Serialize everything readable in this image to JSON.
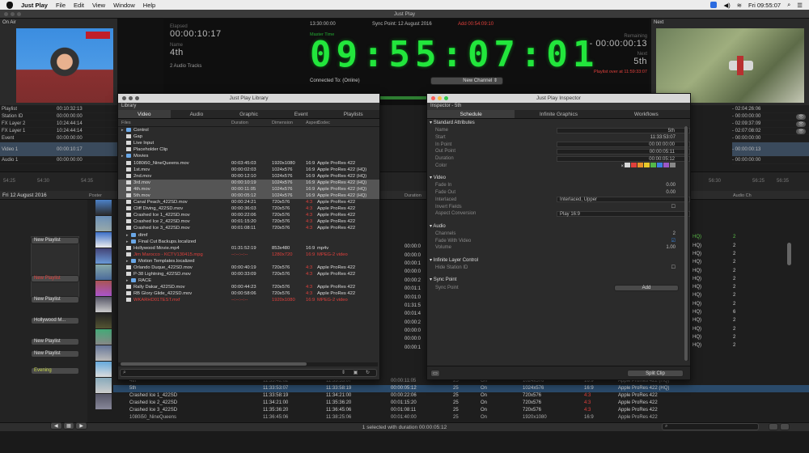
{
  "menubar": {
    "app": "Just Play",
    "items": [
      "File",
      "Edit",
      "View",
      "Window",
      "Help"
    ],
    "clock": "Fri 09:55:07"
  },
  "window": {
    "title": "Just Play"
  },
  "onair": {
    "label": "On Air"
  },
  "next": {
    "label": "Next",
    "remaining_label": "Remaining",
    "remaining": "- 00:00:00:13",
    "name_label": "Next",
    "name": "5th",
    "over_text": "Playlist over at 11:59:33:07"
  },
  "center": {
    "top_time": "13:30:00:00",
    "sync_point": "Sync Point: 12 August 2016",
    "countdown_red": "Add 00:54:09:10",
    "elapsed_label": "Elapsed",
    "elapsed": "00:00:10:17",
    "name_label": "Name",
    "name": "4th",
    "audio_tracks": "2 Audio Tracks",
    "master_time_label": "Master Time",
    "clock": "09:55:07:01",
    "connected": "Connected To: (Online)",
    "channel": "New Channel"
  },
  "left_table": [
    {
      "k": "Playlist",
      "v": "00:10:32:13"
    },
    {
      "k": "Station ID",
      "v": "00:00:00:00"
    },
    {
      "k": "FX Layer 2",
      "v": "10:24:44:14"
    },
    {
      "k": "FX Layer 1",
      "v": "10:24:44:14"
    },
    {
      "k": "Event",
      "v": "00:00:00:00"
    },
    {
      "k": "Video 1",
      "v": "00:00:10:17"
    },
    {
      "k": "Audio 1",
      "v": "00:00:00:00"
    }
  ],
  "right_table": [
    "- 02:04:26:06",
    "- 00:00:00:00",
    "- 02:09:37:09",
    "- 02:07:08:02",
    "- 00:00:00:00",
    "- 00:00:00:13",
    "- 00:00:00:00"
  ],
  "date_label": "Fri 12 August 2016",
  "poster_label": "Poster",
  "playlists": [
    "New Playlist",
    "New Playlist",
    "New Playlist",
    "Hollywood M...",
    "New Playlist",
    "New Playlist",
    "Evening"
  ],
  "library": {
    "title": "Just Play Library",
    "sub": "Library",
    "tabs": [
      "Video",
      "Audio",
      "Graphic",
      "Event",
      "Playlists"
    ],
    "columns": [
      "Files",
      "Duration",
      "Dimension",
      "Aspect",
      "Codec"
    ],
    "rows": [
      {
        "n": "Control",
        "t": "folder",
        "lvl": 0,
        "d": "",
        "dim": "",
        "a": "",
        "c": ""
      },
      {
        "n": "Gap",
        "t": "file",
        "lvl": 1,
        "d": "",
        "dim": "",
        "a": "",
        "c": ""
      },
      {
        "n": "Live Input",
        "t": "file",
        "lvl": 1,
        "d": "",
        "dim": "",
        "a": "",
        "c": ""
      },
      {
        "n": "Placeholder Clip",
        "t": "file",
        "lvl": 1,
        "d": "",
        "dim": "",
        "a": "",
        "c": ""
      },
      {
        "n": "Movies",
        "t": "folder",
        "lvl": 0,
        "d": "",
        "dim": "",
        "a": "",
        "c": ""
      },
      {
        "n": "1080i50_NineQueens.mov",
        "t": "file",
        "lvl": 1,
        "d": "00:03:45:03",
        "dim": "1920x1080",
        "a": "16:9",
        "c": "Apple ProRes 422"
      },
      {
        "n": "1st.mov",
        "t": "file",
        "lvl": 1,
        "d": "00:00:02:03",
        "dim": "1024x576",
        "a": "16:9",
        "c": "Apple ProRes 422 (HQ)"
      },
      {
        "n": "2nd.mov",
        "t": "file",
        "lvl": 1,
        "d": "00:00:12:10",
        "dim": "1024x576",
        "a": "16:9",
        "c": "Apple ProRes 422 (HQ)"
      },
      {
        "n": "3rd.mov",
        "t": "file",
        "lvl": 1,
        "d": "00:00:10:19",
        "dim": "1024x576",
        "a": "16:9",
        "c": "Apple ProRes 422 (HQ)",
        "sel": true
      },
      {
        "n": "4th.mov",
        "t": "file",
        "lvl": 1,
        "d": "00:00:11:05",
        "dim": "1024x576",
        "a": "16:9",
        "c": "Apple ProRes 422 (HQ)",
        "sel": true
      },
      {
        "n": "5th.mov",
        "t": "file",
        "lvl": 1,
        "d": "00:00:05:12",
        "dim": "1024x576",
        "a": "16:9",
        "c": "Apple ProRes 422 (HQ)",
        "sel": true
      },
      {
        "n": "Canal Peach_422SD.mov",
        "t": "file",
        "lvl": 1,
        "d": "00:00:24:21",
        "dim": "720x576",
        "a": "4:3",
        "c": "Apple ProRes 422"
      },
      {
        "n": "Cliff Diving_422SD.mov",
        "t": "file",
        "lvl": 1,
        "d": "00:00:36:03",
        "dim": "720x576",
        "a": "4:3",
        "c": "Apple ProRes 422"
      },
      {
        "n": "Crashed Ice 1_422SD.mov",
        "t": "file",
        "lvl": 1,
        "d": "00:00:22:06",
        "dim": "720x576",
        "a": "4:3",
        "c": "Apple ProRes 422"
      },
      {
        "n": "Crashed Ice 2_422SD.mov",
        "t": "file",
        "lvl": 1,
        "d": "00:01:15:20",
        "dim": "720x576",
        "a": "4:3",
        "c": "Apple ProRes 422"
      },
      {
        "n": "Crashed Ice 3_422SD.mov",
        "t": "file",
        "lvl": 1,
        "d": "00:01:08:11",
        "dim": "720x576",
        "a": "4:3",
        "c": "Apple ProRes 422"
      },
      {
        "n": "dtmf",
        "t": "folder",
        "lvl": 1,
        "d": "",
        "dim": "",
        "a": "",
        "c": ""
      },
      {
        "n": "Final Cut Backups.localized",
        "t": "folder",
        "lvl": 1,
        "d": "",
        "dim": "",
        "a": "",
        "c": ""
      },
      {
        "n": "Hollywood Movie.mp4",
        "t": "file",
        "lvl": 1,
        "d": "01:31:52:19",
        "dim": "853x480",
        "a": "16:9",
        "c": "mp4v"
      },
      {
        "n": "Jim Marocco - KCTV130415.mpg",
        "t": "file",
        "lvl": 1,
        "d": "--:--:--:--",
        "dim": "1280x720",
        "a": "16:9",
        "c": "MPEG-2 video",
        "red": true
      },
      {
        "n": "Motion Templates.localized",
        "t": "folder",
        "lvl": 1,
        "d": "",
        "dim": "",
        "a": "",
        "c": ""
      },
      {
        "n": "Orlando Duque_422SD.mov",
        "t": "file",
        "lvl": 1,
        "d": "00:00:40:19",
        "dim": "720x576",
        "a": "4:3",
        "c": "Apple ProRes 422"
      },
      {
        "n": "P-38 Lightning_422SD.mov",
        "t": "file",
        "lvl": 1,
        "d": "00:00:33:09",
        "dim": "720x576",
        "a": "4:3",
        "c": "Apple ProRes 422"
      },
      {
        "n": "RACE",
        "t": "folder",
        "lvl": 1,
        "d": "",
        "dim": "",
        "a": "",
        "c": ""
      },
      {
        "n": "Rally Dakar_422SD.mov",
        "t": "file",
        "lvl": 1,
        "d": "00:00:44:23",
        "dim": "720x576",
        "a": "4:3",
        "c": "Apple ProRes 422"
      },
      {
        "n": "RB Glory Glide_422SD.mov",
        "t": "file",
        "lvl": 1,
        "d": "00:00:58:06",
        "dim": "720x576",
        "a": "4:3",
        "c": "Apple ProRes 422"
      },
      {
        "n": "WKARHD01TEST.mxf",
        "t": "file",
        "lvl": 1,
        "d": "--:--:--:--",
        "dim": "1920x1080",
        "a": "16:9",
        "c": "MPEG-2 video",
        "red": true
      }
    ]
  },
  "inspector": {
    "title": "Just Play Inspector",
    "sub": "Inspector - 5th",
    "tabs": [
      "Schedule",
      "Infinite Graphics",
      "Workflows"
    ],
    "standard": {
      "header": "Standard Attributes",
      "rows": [
        [
          "Name",
          "5th"
        ],
        [
          "Start",
          "11:33:53:07"
        ],
        [
          "In Point",
          "00:00:00:00"
        ],
        [
          "Out Point",
          "00:00:05:11"
        ],
        [
          "Duration",
          "00:00:05:12"
        ],
        [
          "Color",
          ""
        ]
      ]
    },
    "video": {
      "header": "Video",
      "rows": [
        [
          "Fade In",
          "0.00"
        ],
        [
          "Fade Out",
          "0.00"
        ],
        [
          "Interlaced",
          "Interlaced, Upper"
        ],
        [
          "Invert Fields",
          ""
        ],
        [
          "Aspect Conversion",
          "Play 16:9"
        ]
      ]
    },
    "audio": {
      "header": "Audio",
      "rows": [
        [
          "Channels",
          "2"
        ],
        [
          "Fade With Video",
          ""
        ],
        [
          "Volume",
          "1.00"
        ]
      ]
    },
    "infinite": {
      "header": "Infinite Layer Control",
      "rows": [
        [
          "Hide Station ID",
          ""
        ]
      ]
    },
    "sync": {
      "header": "Sync Point",
      "rows": [
        [
          "Sync Point",
          ""
        ]
      ]
    },
    "add_button": "Add",
    "split_button": "Split Clip",
    "colors": [
      "#d8d8d8",
      "#e0403c",
      "#e8902a",
      "#e8c92a",
      "#54b848",
      "#3a7ee0",
      "#9a58c8",
      "#888888"
    ]
  },
  "timeline": {
    "duration_label": "Duration",
    "audio_label": "Audio Ch",
    "ruler_left": [
      "54:25",
      "54:30",
      "54:35"
    ],
    "ruler_right": [
      "56:30",
      "56:25",
      "56:35"
    ],
    "mid_times": [
      "00:00:0",
      "00:00:0",
      "00:00:1",
      "00:00:0",
      "00:00:2",
      "00:01:1",
      "00:01:0",
      "01:31:5",
      "00:01:4",
      "00:00:2",
      "00:00:0",
      "00:00:0",
      "00:00:1"
    ],
    "right_rows": [
      {
        "aspect": "HQ)",
        "ch": "2"
      },
      {
        "aspect": "HQ)",
        "ch": "2"
      },
      {
        "aspect": "HQ)",
        "ch": "2"
      },
      {
        "aspect": "HQ)",
        "ch": "2"
      },
      {
        "aspect": "HQ)",
        "ch": "2"
      },
      {
        "aspect": "HQ)",
        "ch": "2"
      },
      {
        "aspect": "HQ)",
        "ch": "2"
      },
      {
        "aspect": "HQ)",
        "ch": "2"
      },
      {
        "aspect": "HQ)",
        "ch": "2"
      },
      {
        "aspect": "HQ)",
        "ch": "6"
      },
      {
        "aspect": "HQ)",
        "ch": "2"
      },
      {
        "aspect": "HQ)",
        "ch": "2"
      },
      {
        "aspect": "HQ)",
        "ch": "2"
      },
      {
        "aspect": "HQ)",
        "ch": "2"
      }
    ],
    "bottom_rows": [
      {
        "n": "4th",
        "s": "11:33:42:02",
        "e": "11:33:53:07",
        "d": "00:00:11:05",
        "fps": "25",
        "on": "On",
        "dim": "1024x576",
        "a": "16:9",
        "c": "Apple ProRes 422 (HQ)"
      },
      {
        "n": "5th",
        "s": "11:33:53:07",
        "e": "11:33:58:19",
        "d": "00:00:05:12",
        "fps": "25",
        "on": "On",
        "dim": "1024x576",
        "a": "16:9",
        "c": "Apple ProRes 422 (HQ)",
        "sel": true
      },
      {
        "n": "Crashed Ice 1_422SD",
        "s": "11:33:58:19",
        "e": "11:34:21:00",
        "d": "00:00:22:06",
        "fps": "25",
        "on": "On",
        "dim": "720x576",
        "a": "4:3",
        "c": "Apple ProRes 422"
      },
      {
        "n": "Crashed Ice 2_422SD",
        "s": "11:34:21:00",
        "e": "11:35:36:20",
        "d": "00:01:15:20",
        "fps": "25",
        "on": "On",
        "dim": "720x576",
        "a": "4:3",
        "c": "Apple ProRes 422"
      },
      {
        "n": "Crashed Ice 3_422SD",
        "s": "11:35:36:20",
        "e": "11:36:45:06",
        "d": "00:01:08:11",
        "fps": "25",
        "on": "On",
        "dim": "720x576",
        "a": "4:3",
        "c": "Apple ProRes 422"
      },
      {
        "n": "1080i50_NineQueens",
        "s": "11:36:45:06",
        "e": "11:38:25:06",
        "d": "00:01:40:00",
        "fps": "25",
        "on": "On",
        "dim": "1920x1080",
        "a": "16:9",
        "c": "Apple ProRes 422"
      }
    ],
    "status": "1 selected with duration 00:00:05:12"
  },
  "search": {
    "placeholder": ""
  }
}
